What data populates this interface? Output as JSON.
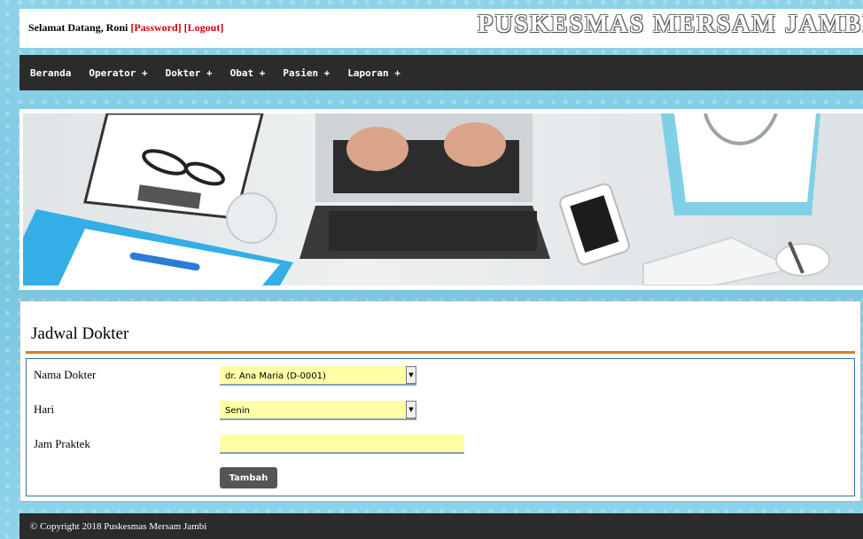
{
  "header": {
    "welcome_prefix": "Selamat Datang, Roni ",
    "password_link": "[Password]",
    "logout_link": "[Logout]",
    "site_title": "PUSKESMAS MERSAM JAMBI"
  },
  "nav": {
    "items": [
      {
        "label": "Beranda"
      },
      {
        "label": "Operator +"
      },
      {
        "label": "Dokter +"
      },
      {
        "label": "Obat +"
      },
      {
        "label": "Pasien +"
      },
      {
        "label": "Laporan +"
      }
    ]
  },
  "main": {
    "title": "Jadwal Dokter",
    "fields": {
      "nama_dokter": {
        "label": "Nama Dokter",
        "value": "dr. Ana Maria (D-0001)"
      },
      "hari": {
        "label": "Hari",
        "value": "Senin"
      },
      "jam_praktek": {
        "label": "Jam Praktek",
        "value": ""
      }
    },
    "submit_label": "Tambah"
  },
  "footer": {
    "copyright": "© Copyright 2018 Puskesmas Mersam Jambi"
  },
  "colors": {
    "accent_orange": "#e07b1f",
    "input_yellow": "#ffffa6",
    "nav_bg": "#2b2b2b",
    "link_red": "#d40000"
  }
}
